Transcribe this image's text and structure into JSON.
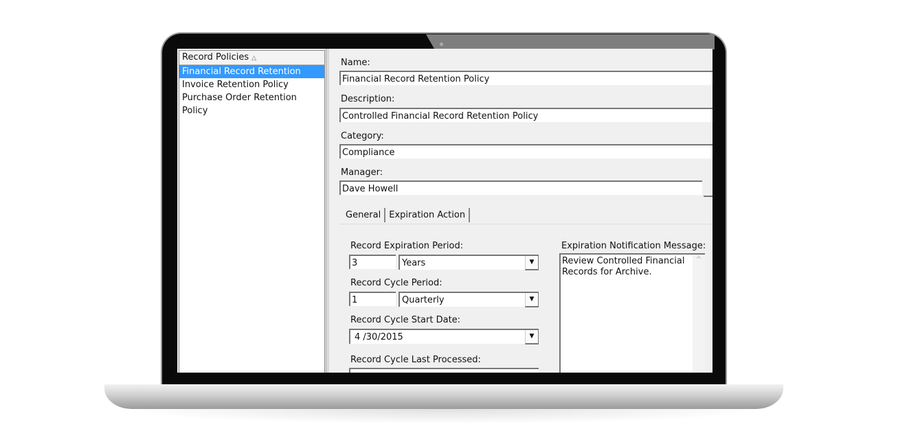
{
  "list": {
    "header": "Record Policies",
    "sort_icon": "sort-triangle-icon",
    "items": [
      "Financial Record Retention Policy",
      "Invoice Retention Policy",
      "Purchase Order Retention Policy"
    ],
    "selected": 0
  },
  "form": {
    "name_label": "Name:",
    "name_value": "Financial Record Retention Policy",
    "description_label": "Description:",
    "description_value": "Controlled Financial Record Retention Policy",
    "category_label": "Category:",
    "category_value": "Compliance",
    "manager_label": "Manager:",
    "manager_value": "Dave Howell"
  },
  "tabs": [
    "General",
    "Expiration Action"
  ],
  "general": {
    "expiration_period_label": "Record Expiration Period:",
    "expiration_period_value": "3",
    "expiration_period_unit": "Years",
    "cycle_period_label": "Record Cycle Period:",
    "cycle_period_value": "1",
    "cycle_period_unit": "Quarterly",
    "cycle_start_label": "Record Cycle Start Date:",
    "cycle_start_value": "4 /30/2015",
    "last_processed_label": "Record Cycle Last Processed:",
    "notification_label": "Expiration Notification Message:",
    "notification_value": "Review Controlled Financial Records for Archive."
  },
  "colors": {
    "selection": "#3399ff",
    "panel": "#f0f0f0"
  }
}
